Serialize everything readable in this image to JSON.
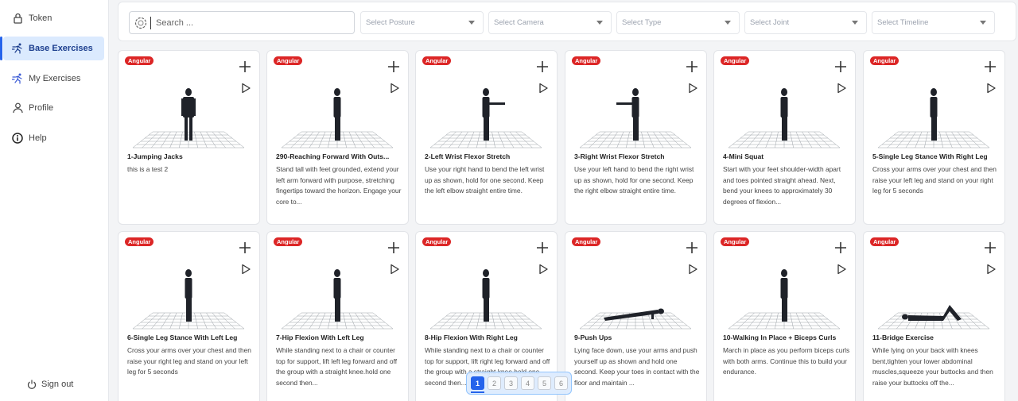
{
  "sidebar": {
    "items": [
      {
        "label": "Token",
        "icon": "lock-icon"
      },
      {
        "label": "Base Exercises",
        "icon": "runner-icon",
        "active": true
      },
      {
        "label": "My Exercises",
        "icon": "runner-icon"
      },
      {
        "label": "Profile",
        "icon": "user-icon"
      },
      {
        "label": "Help",
        "icon": "info-circle-icon"
      }
    ],
    "signout_label": "Sign out"
  },
  "filters": {
    "search_placeholder": "Search ...",
    "posture": "Select Posture",
    "camera": "Select Camera",
    "type": "Select Type",
    "joint": "Select Joint",
    "timeline": "Select Timeline"
  },
  "colors": {
    "accent": "#2563eb",
    "badge": "#dc2626",
    "active_bg": "#dbeafe"
  },
  "cards": [
    {
      "badge": "Angular",
      "title": "1-Jumping Jacks",
      "description": "this is a test 2",
      "pose": "front"
    },
    {
      "badge": "Angular",
      "title": "290-Reaching Forward With Outs...",
      "description": "Stand tall with feet grounded, extend your left arm forward with purpose, stretching fingertips toward the horizon. Engage your core to...",
      "pose": "side"
    },
    {
      "badge": "Angular",
      "title": "2-Left Wrist Flexor Stretch",
      "description": "Use your right hand to bend the left wrist up as shown, hold for one second. Keep the left elbow straight entire time.",
      "pose": "arm-right"
    },
    {
      "badge": "Angular",
      "title": "3-Right Wrist Flexor Stretch",
      "description": "Use your left hand to bend the right wrist up as shown, hold for one second. Keep the right elbow straight entire time.",
      "pose": "arm-left"
    },
    {
      "badge": "Angular",
      "title": "4-Mini Squat",
      "description": "Start with your feet shoulder-width apart and toes pointed straight ahead. Next, bend your knees to approximately 30 degrees of flexion...",
      "pose": "side"
    },
    {
      "badge": "Angular",
      "title": "5-Single Leg Stance With Right Leg",
      "description": "Cross your arms over your chest and then raise your left leg and stand on your right leg for 5 seconds",
      "pose": "side"
    },
    {
      "badge": "Angular",
      "title": "6-Single Leg Stance With Left Leg",
      "description": "Cross your arms over your chest and then raise your right leg and stand on your left leg for 5 seconds",
      "pose": "side"
    },
    {
      "badge": "Angular",
      "title": "7-Hip Flexion With Left Leg",
      "description": "While standing next to a chair or counter top for support, lift left leg forward and off the group with a straight knee.hold one second then...",
      "pose": "side"
    },
    {
      "badge": "Angular",
      "title": "8-Hip Flexion With Right Leg",
      "description": "While standing next to a chair or counter top for support, lift right leg forward and off the group with a straight knee.hold one second then...",
      "pose": "side"
    },
    {
      "badge": "Angular",
      "title": "9-Push Ups",
      "description": "Lying face down, use your arms and push yourself up as shown and hold one second. Keep your toes in contact with the floor and maintain ...",
      "pose": "prone"
    },
    {
      "badge": "Angular",
      "title": "10-Walking In Place + Biceps Curls",
      "description": "March in place as you perform biceps curls with both arms. Continue this to build your endurance.",
      "pose": "side"
    },
    {
      "badge": "Angular",
      "title": "11-Bridge Exercise",
      "description": "While lying on your back with knees bent,tighten your lower abdominal muscles,squeeze your buttocks and then raise your buttocks off the...",
      "pose": "supine"
    }
  ],
  "pagination": {
    "pages": [
      "1",
      "2",
      "3",
      "4",
      "5",
      "6"
    ],
    "current": "1"
  }
}
